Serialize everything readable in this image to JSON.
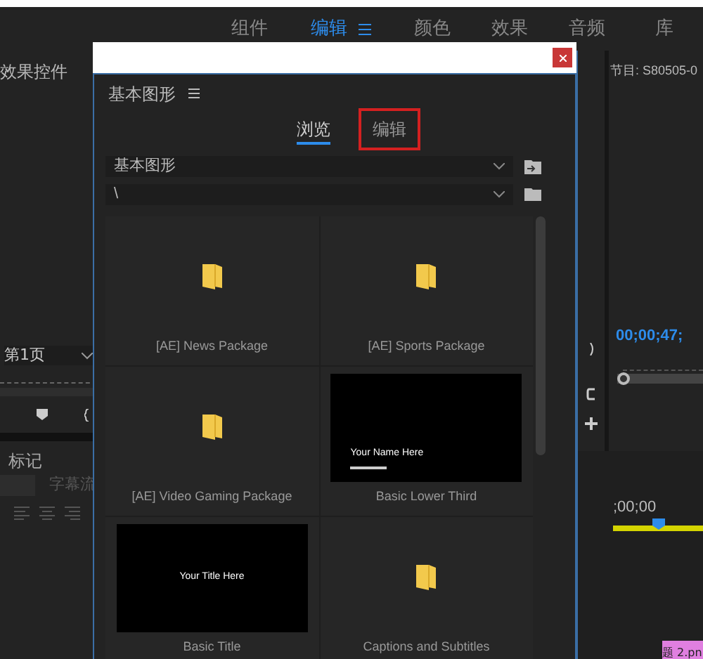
{
  "workspace_tabs": [
    {
      "label": "组件",
      "selected": false
    },
    {
      "label": "编辑",
      "selected": true
    },
    {
      "label": "颜色",
      "selected": false
    },
    {
      "label": "效果",
      "selected": false
    },
    {
      "label": "音频",
      "selected": false
    },
    {
      "label": "库",
      "selected": false
    }
  ],
  "effects_panel": {
    "title": "效果控件",
    "page_select": "第1页",
    "tabs": [
      {
        "label": "标记"
      }
    ],
    "caption_label": "字幕流"
  },
  "program_monitor": {
    "title": "节目: S80505-0",
    "timecode": "00;00;47;",
    "scrollbar": {
      "level": 0
    }
  },
  "timeline": {
    "timecode": ";00;00",
    "clip": "题 2.pn"
  },
  "dialog": {
    "panel_title": "基本图形",
    "tabs": [
      {
        "label": "浏览",
        "selected": true,
        "highlighted": false
      },
      {
        "label": "编辑",
        "selected": false,
        "highlighted": true
      }
    ],
    "library_select": "基本图形",
    "path_select": "\\",
    "templates": [
      {
        "name": "[AE] News Package",
        "kind": "folder"
      },
      {
        "name": "[AE] Sports Package",
        "kind": "folder"
      },
      {
        "name": "[AE] Video Gaming Package",
        "kind": "folder"
      },
      {
        "name": "Basic Lower Third",
        "kind": "lower_third",
        "preview_text": "Your Name Here"
      },
      {
        "name": "Basic Title",
        "kind": "title",
        "preview_text": "Your Title Here"
      },
      {
        "name": "Captions and Subtitles",
        "kind": "folder"
      }
    ]
  }
}
